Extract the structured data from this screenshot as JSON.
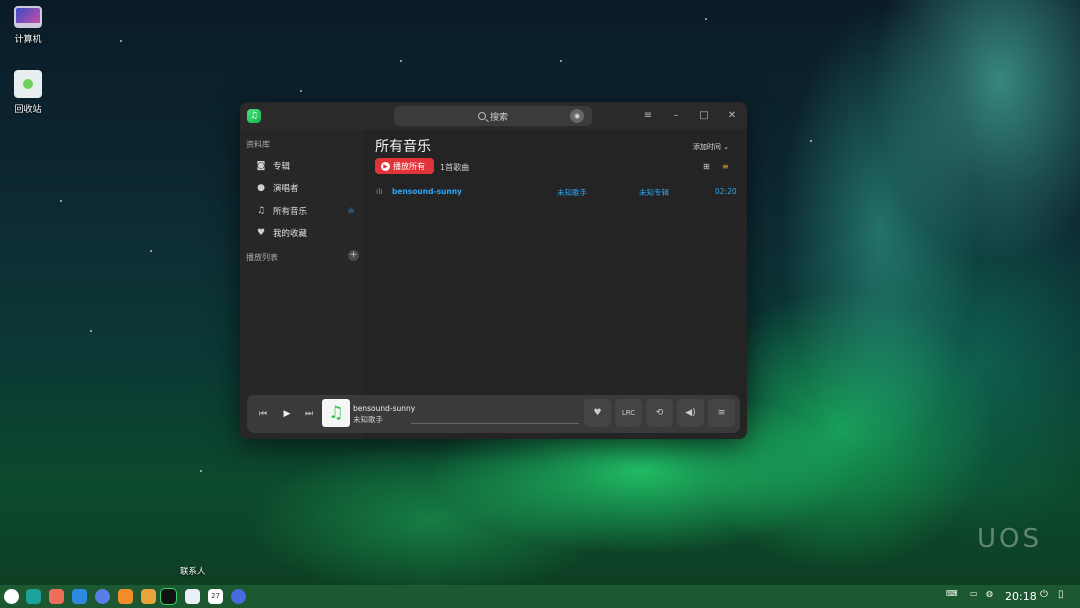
{
  "desktop": {
    "icons": [
      {
        "label": "计算机",
        "icon": "computer-icon"
      },
      {
        "label": "回收站",
        "icon": "trash-icon"
      }
    ],
    "watermark": "UOS"
  },
  "window": {
    "search": {
      "placeholder": "搜索"
    },
    "sidebar": {
      "library_label": "资料库",
      "items": [
        {
          "label": "专辑",
          "icon": "album-icon"
        },
        {
          "label": "演唱者",
          "icon": "artist-icon"
        },
        {
          "label": "所有音乐",
          "icon": "music-note-icon"
        },
        {
          "label": "我的收藏",
          "icon": "heart-icon"
        }
      ],
      "playlist_label": "播放列表"
    },
    "main": {
      "title": "所有音乐",
      "sort_label": "添加时间",
      "play_all_label": "播放所有",
      "song_count": "1首歌曲",
      "songs": [
        {
          "title": "bensound-sunny",
          "artist": "未知歌手",
          "album": "未知专辑",
          "duration": "02:20"
        }
      ]
    },
    "player": {
      "title": "bensound-sunny",
      "artist": "未知歌手",
      "lrc_label": "LRC"
    }
  },
  "taskbar": {
    "tooltip": "联系人",
    "clock": "20:18",
    "date_badge": "27",
    "accent": "#2ca7f8",
    "play_all_color": "#e0343a"
  }
}
